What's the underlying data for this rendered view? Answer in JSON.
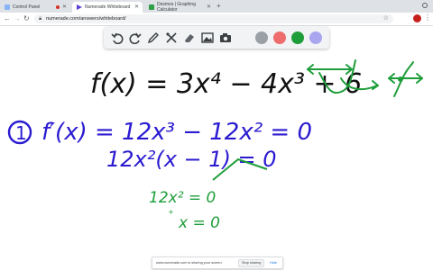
{
  "browser": {
    "tabs": [
      {
        "title": "Control Panel",
        "active": false
      },
      {
        "title": "Numerade Whiteboard",
        "active": true
      },
      {
        "title": "Desmos | Graphing Calculator",
        "active": false
      }
    ],
    "address": "numerade.com/answers/whiteboard/"
  },
  "whiteboard": {
    "tools": [
      "undo-icon",
      "redo-icon",
      "pen-icon",
      "tools-icon",
      "eraser-icon",
      "image-icon",
      "camera-icon"
    ],
    "colors": [
      {
        "name": "gray",
        "hex": "#9aa0a6"
      },
      {
        "name": "red",
        "hex": "#ef6c6c"
      },
      {
        "name": "green",
        "hex": "#1e9e3a"
      },
      {
        "name": "lavender",
        "hex": "#a9a6f0"
      }
    ],
    "ink": {
      "black": "#111111",
      "blue": "#2a1bd0",
      "green": "#1e9e3a"
    }
  },
  "handwriting": {
    "line1": "f(x) = 3x⁴ − 4x³ + 6",
    "step_number": "1",
    "line2": "f′(x) = 12x³ − 12x² = 0",
    "line3": "12x²(x − 1) = 0",
    "line4": "12x² = 0",
    "line5": "x = 0"
  },
  "sharing_bar": {
    "message": "www.numerade.com is sharing your screen.",
    "stop_label": "Stop sharing",
    "hide_label": "Hide"
  }
}
